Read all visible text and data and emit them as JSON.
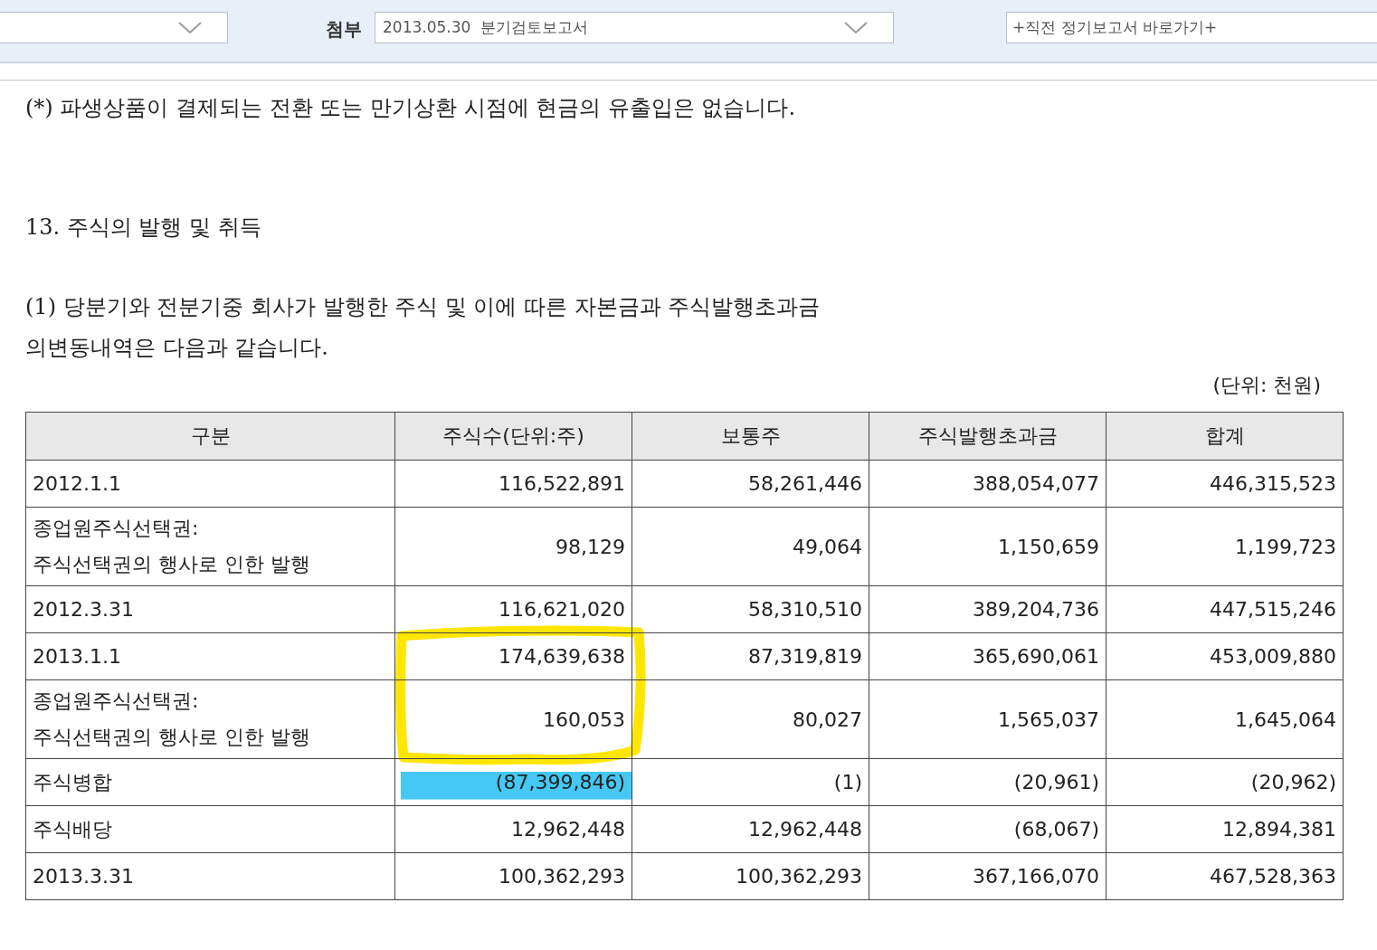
{
  "toolbar": {
    "attach_label": "첨부",
    "attach_select": {
      "value": "2013.05.30  분기검토보고서"
    },
    "shortcut_field": {
      "value": "+직전 정기보고서 바로가기+"
    }
  },
  "note": "(*) 파생상품이 결제되는 전환 또는 만기상환 시점에 현금의 유출입은 없습니다.",
  "section_title": "13. 주식의 발행 및 취득",
  "paragraph": "(1) 당분기와 전분기중 회사가 발행한 주식 및 이에 따른 자본금과 주식발행초과금\n의변동내역은 다음과 같습니다.",
  "unit": "(단위: 천원)",
  "table": {
    "columns": [
      "구분",
      "주식수(단위:주)",
      "보통주",
      "주식발행초과금",
      "합계"
    ],
    "rows": [
      {
        "cells": [
          "2012.1.1",
          "116,522,891",
          "58,261,446",
          "388,054,077",
          "446,315,523"
        ],
        "highlighted": false
      },
      {
        "cells": [
          "종업원주식선택권:\n주식선택권의 행사로 인한 발행",
          "98,129",
          "49,064",
          "1,150,659",
          "1,199,723"
        ],
        "highlighted": false
      },
      {
        "cells": [
          "2012.3.31",
          "116,621,020",
          "58,310,510",
          "389,204,736",
          "447,515,246"
        ],
        "highlighted": false
      },
      {
        "cells": [
          "2013.1.1",
          "174,639,638",
          "87,319,819",
          "365,690,061",
          "453,009,880"
        ],
        "highlighted": false
      },
      {
        "cells": [
          "종업원주식선택권:\n주식선택권의 행사로 인한 발행",
          "160,053",
          "80,027",
          "1,565,037",
          "1,645,064"
        ],
        "highlighted": false
      },
      {
        "cells": [
          "주식병합",
          "(87,399,846)",
          "(1)",
          "(20,961)",
          "(20,962)"
        ],
        "highlighted": true
      },
      {
        "cells": [
          "주식배당",
          "12,962,448",
          "12,962,448",
          "(68,067)",
          "12,894,381"
        ],
        "highlighted": false
      },
      {
        "cells": [
          "2013.3.31",
          "100,362,293",
          "100,362,293",
          "367,166,070",
          "467,528,363"
        ],
        "highlighted": false
      }
    ]
  }
}
